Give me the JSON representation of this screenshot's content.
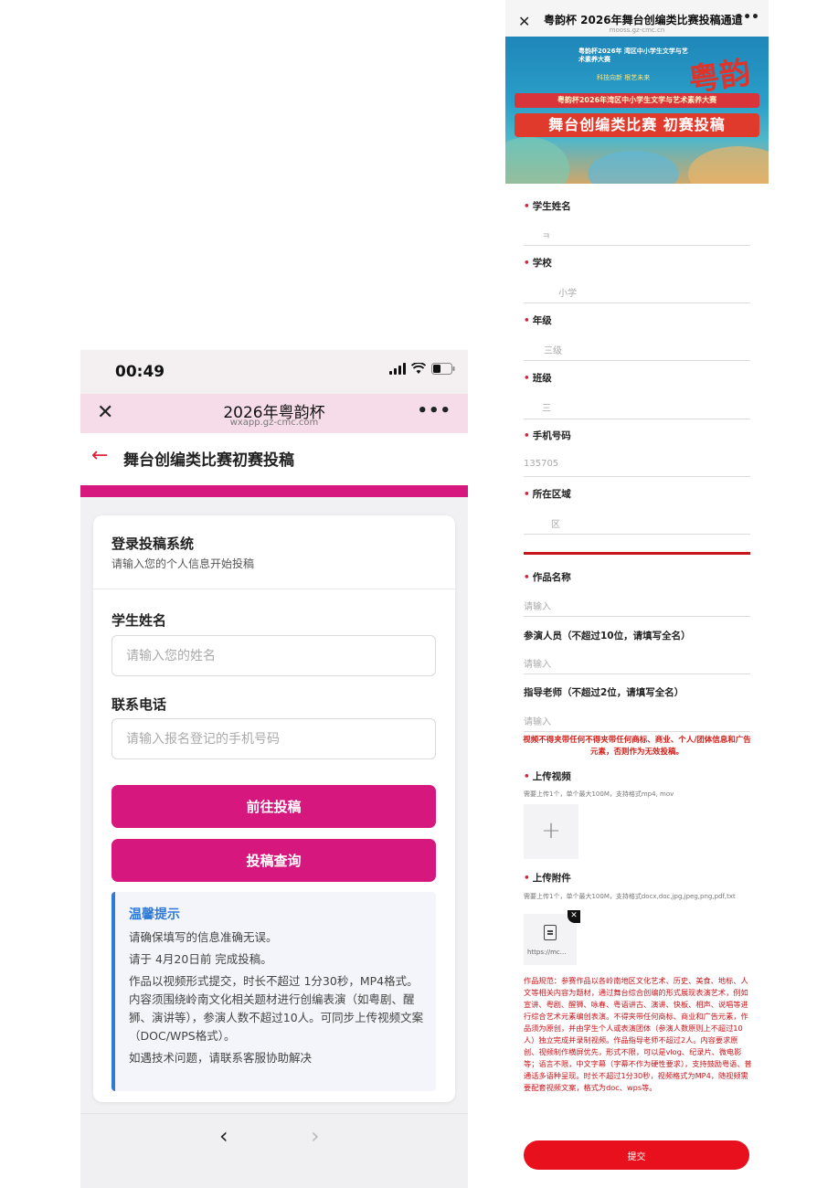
{
  "left": {
    "status_time": "00:49",
    "nav": {
      "title": "2026年粤韵杯",
      "url": "wxapp.gz-cmc.com",
      "close": "✕",
      "more": "•••"
    },
    "page_title": "舞台创编类比赛初赛投稿",
    "back_arrow": "←",
    "card": {
      "title": "登录投稿系统",
      "subtitle": "请输入您的个人信息开始投稿",
      "name_label": "学生姓名",
      "name_placeholder": "请输入您的姓名",
      "phone_label": "联系电话",
      "phone_placeholder": "请输入报名登记的手机号码",
      "submit_label": "前往投稿",
      "query_label": "投稿查询"
    },
    "tips": {
      "title": "温馨提示",
      "lines": [
        "请确保填写的信息准确无误。",
        "请于 4月20日前 完成投稿。",
        "作品以视频形式提交，时长不超过 1分30秒，MP4格式。内容须围绕岭南文化相关题材进行创编表演（如粤剧、醒狮、演讲等），参演人数不超过10人。可同步上传视频文案（DOC/WPS格式）。",
        "如遇技术问题，请联系客服协助解决"
      ]
    },
    "bottom": {
      "prev": "‹",
      "next": "›"
    },
    "colors": {
      "accent": "#d6177e",
      "tips_accent": "#2f7ad6",
      "back": "#e0213b"
    }
  },
  "right": {
    "nav": {
      "title": "粤韵杯 2026年舞台创编类比赛投稿通道",
      "url": "mooss.gz-cmc.cn",
      "close": "✕",
      "more": "•••"
    },
    "banner": {
      "top_text": "粤韵杯2026年 湾区中小学生文学与艺术素养大赛",
      "slogan": "科技向新 根艺未来",
      "logo": "粤韵",
      "ribbon": "粤韵杯2026年湾区中小学生文学与艺术素养大赛",
      "main": "舞台创编类比赛 初赛投稿"
    },
    "fields": [
      {
        "label": "学生姓名",
        "value": "ㅋ"
      },
      {
        "label": "学校",
        "value": "小学"
      },
      {
        "label": "年级",
        "value": "三级"
      },
      {
        "label": "班级",
        "value": "三"
      },
      {
        "label": "手机号码",
        "value": "135705"
      },
      {
        "label": "所在区域",
        "value": "区"
      }
    ],
    "work": {
      "name_label": "作品名称",
      "name_placeholder": "请输入",
      "performers_label": "参演人员（不超过10位，请填写全名）",
      "performers_placeholder": "请输入",
      "teachers_label": "指导老师（不超过2位，请填写全名）",
      "teachers_placeholder": "请输入"
    },
    "warning": "视频不得夹带任何不得夹带任何商标、商业、个人/团体信息和广告元素，否则作为无效投稿。",
    "upload_video": {
      "label": "上传视频",
      "note": "需要上传1个，单个最大100M，支持格式mp4, mov",
      "plus": "+"
    },
    "upload_attachment": {
      "label": "上传附件",
      "note": "需要上传1个，单个最大100M，支持格式docx,doc,jpg,jpeg,png,pdf,txt",
      "file_name": "https://mc..."
    },
    "rules": "作品规范：参赛作品以各岭南地区文化艺术、历史、美食、地标、人文等相关内容为题材，通过舞台综合创编的形式展现表演艺术，例如宣讲、粤剧、醒狮、咏春、粤语讲古、演讲、快板、相声、说唱等进行综合艺术元素编创表演。不得夹带任何商标、商业和广告元素，作品须为原创，并由学生个人或表演团体（参演人数原则上不超过10人）独立完成并录制视频。作品指导老师不超过2人。内容要求原创、视频制作横屏优先，形式不限，可以是vlog、纪录片、微电影等；语言不限，中文字幕（字幕不作为硬性要求），支持鼓励粤语、普通话多语种呈现。时长不超过1分30秒，视频格式为MP4，随视频需要配套视频文案，格式为doc、wps等。",
    "submit_label": "提交",
    "colors": {
      "required": "#e0213b",
      "submit": "#e8101c",
      "separator": "#c8141b"
    }
  }
}
